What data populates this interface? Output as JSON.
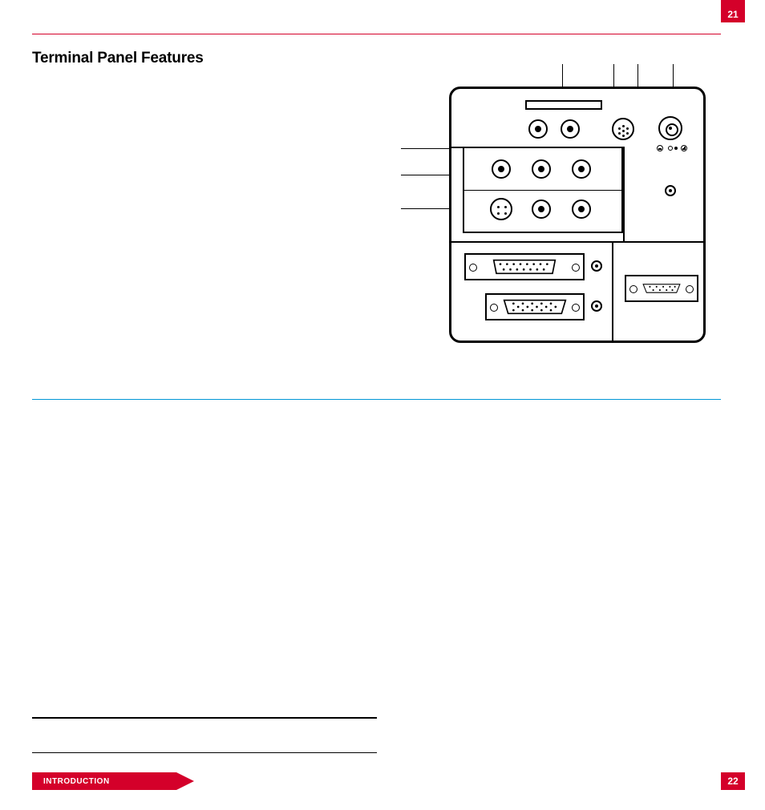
{
  "page_number_top": "21",
  "page_number_bottom": "22",
  "section_title": "Terminal Panel Features",
  "footer_label": "INTRODUCTION"
}
